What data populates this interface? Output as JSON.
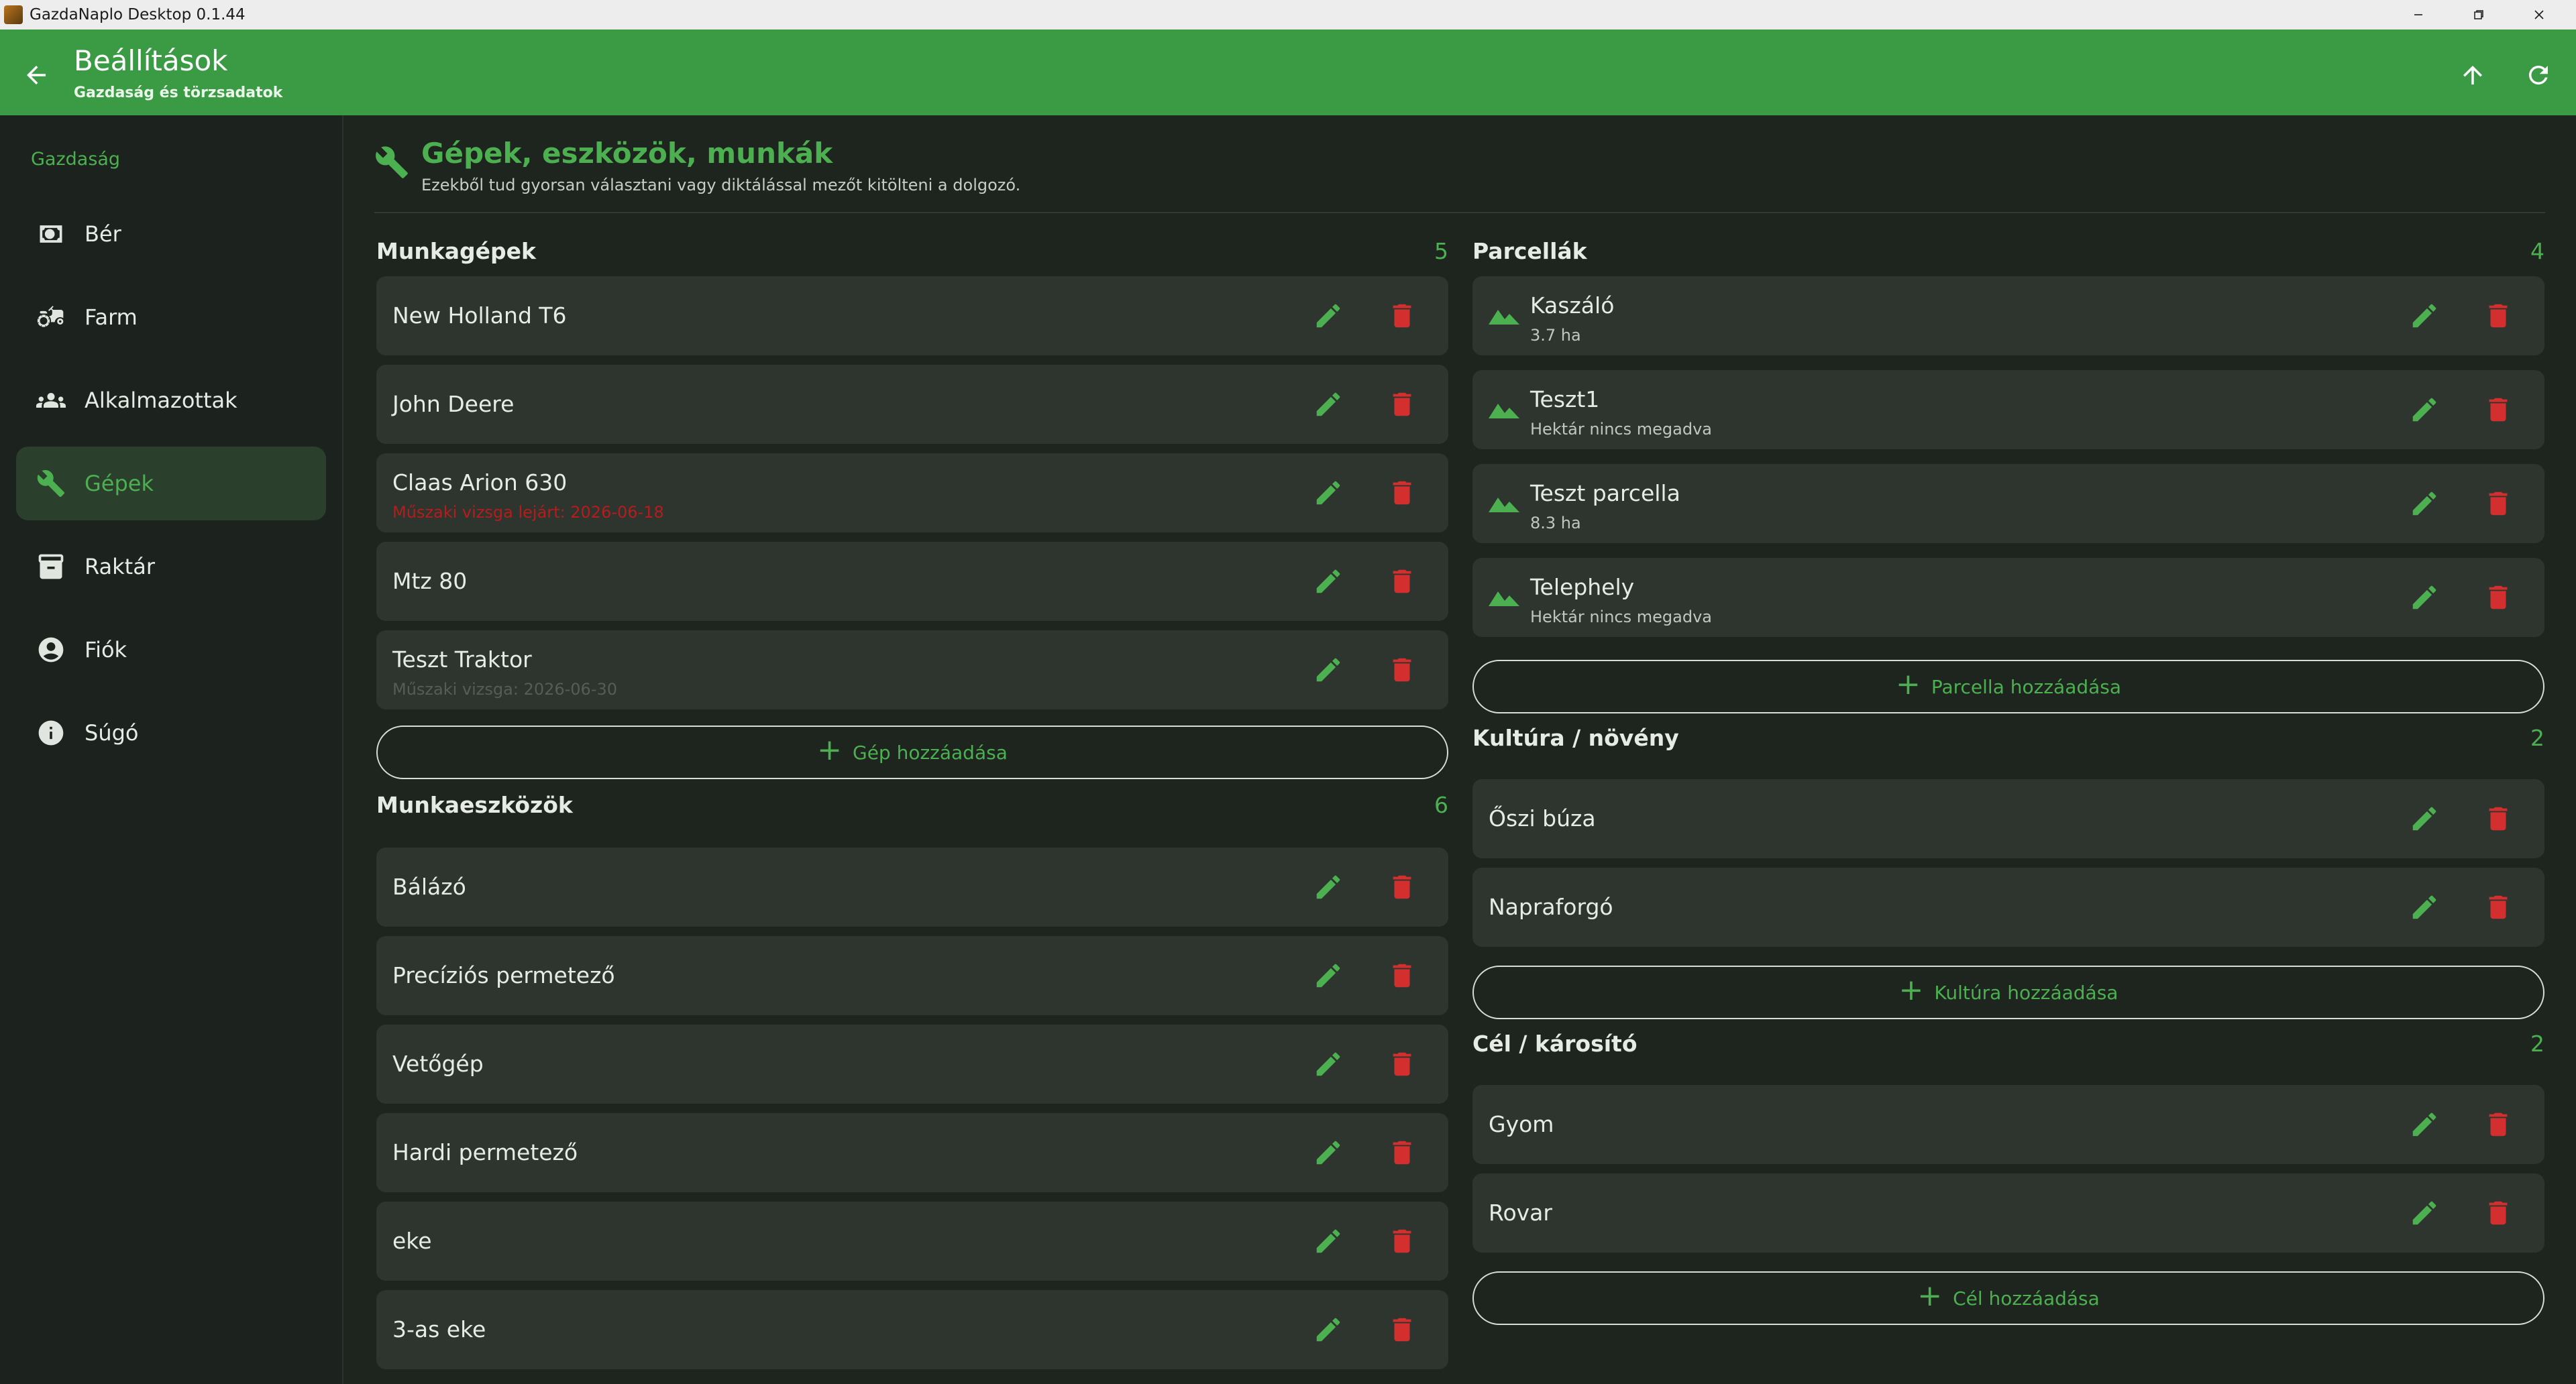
{
  "window": {
    "title": "GazdaNaplo Desktop 0.1.44"
  },
  "header": {
    "title": "Beállítások",
    "subtitle": "Gazdaság és törzsadatok"
  },
  "sidebar": {
    "section": "Gazdaság",
    "items": [
      {
        "label": "Bér",
        "icon": "cash-icon"
      },
      {
        "label": "Farm",
        "icon": "tractor-icon"
      },
      {
        "label": "Alkalmazottak",
        "icon": "people-icon"
      },
      {
        "label": "Gépek",
        "icon": "wrench-icon",
        "active": true
      },
      {
        "label": "Raktár",
        "icon": "archive-icon"
      },
      {
        "label": "Fiók",
        "icon": "account-icon"
      },
      {
        "label": "Súgó",
        "icon": "info-icon"
      }
    ]
  },
  "page": {
    "title": "Gépek, eszközök, munkák",
    "subtitle": "Ezekből tud gyorsan választani vagy diktálással mezőt kitölteni a dolgozó."
  },
  "munkagepek": {
    "title": "Munkagépek",
    "count": "5",
    "items": [
      {
        "name": "New Holland T6",
        "note": ""
      },
      {
        "name": "John Deere",
        "note": ""
      },
      {
        "name": "Claas Arion 630",
        "note": "Műszaki vizsga lejárt: 2026-06-18"
      },
      {
        "name": "Mtz 80",
        "note": ""
      },
      {
        "name": "Teszt Traktor",
        "note": "Műszaki vizsga: 2026-06-30"
      }
    ],
    "add_label": "Gép hozzáadása"
  },
  "munkaeszkozok": {
    "title": "Munkaeszközök",
    "count": "6",
    "items": [
      "Bálázó",
      "Precíziós permetező",
      "Vetőgép",
      "Hardi permetező",
      "eke",
      "3-as eke"
    ]
  },
  "parcellak": {
    "title": "Parcellák",
    "count": "4",
    "items": [
      {
        "name": "Kaszáló",
        "area": "3.7 ha"
      },
      {
        "name": "Teszt1",
        "area": "Hektár nincs megadva"
      },
      {
        "name": "Teszt parcella",
        "area": "8.3 ha"
      },
      {
        "name": "Telephely",
        "area": "Hektár nincs megadva"
      }
    ],
    "add_label": "Parcella hozzáadása"
  },
  "kultura": {
    "title": "Kultúra / növény",
    "count": "2",
    "items": [
      "Őszi búza",
      "Napraforgó"
    ],
    "add_label": "Kultúra hozzáadása"
  },
  "cel": {
    "title": "Cél / károsító",
    "count": "2",
    "items": [
      "Gyom",
      "Rovar"
    ],
    "add_label": "Cél hozzáadása"
  },
  "colors": {
    "accent": "#4caf50",
    "appbar": "#3b9b45",
    "delete": "#d32f2f",
    "expired": "#b71c1c"
  }
}
